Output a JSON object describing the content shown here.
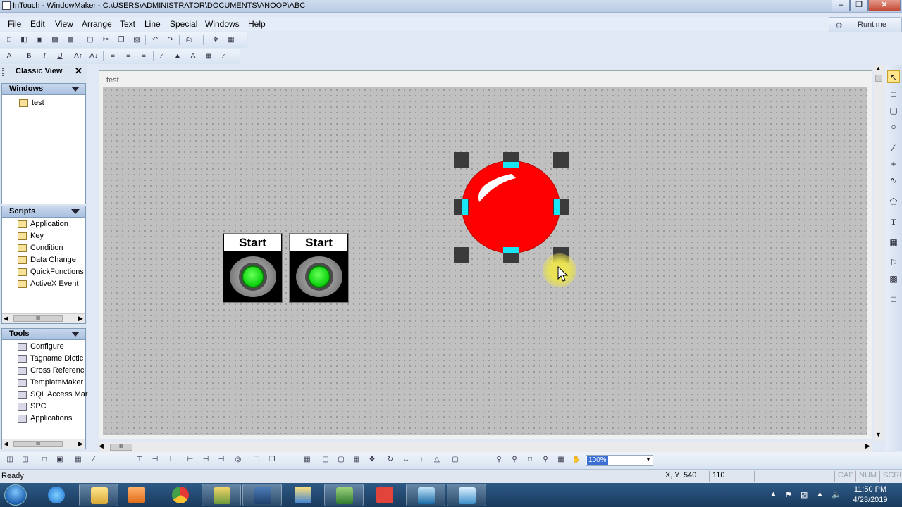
{
  "window": {
    "title": "InTouch - WindowMaker - C:\\USERS\\ADMINISTRATOR\\DOCUMENTS\\ANOOP\\ABC",
    "minimize_icon": "minimize-icon",
    "maximize_icon": "restore-icon",
    "close_icon": "close-icon"
  },
  "menu": {
    "items": [
      "File",
      "Edit",
      "View",
      "Arrange",
      "Text",
      "Line",
      "Special",
      "Windows",
      "Help"
    ],
    "runtime_label": "Runtime"
  },
  "left_panel": {
    "title": "Classic View",
    "windows_section": {
      "title": "Windows",
      "items": [
        "test"
      ]
    },
    "scripts_section": {
      "title": "Scripts",
      "items": [
        "Application",
        "Key",
        "Condition",
        "Data Change",
        "QuickFunctions",
        "ActiveX Event"
      ]
    },
    "tools_section": {
      "title": "Tools",
      "items": [
        "Configure",
        "Tagname Dictic",
        "Cross Reference",
        "TemplateMaker",
        "SQL Access Mar",
        "SPC",
        "Applications"
      ]
    },
    "scroll_thumb": "III"
  },
  "document": {
    "window_name": "test",
    "buttons": [
      {
        "label": "Start",
        "lamp_color": "#14d814"
      },
      {
        "label": "Start",
        "lamp_color": "#14d814"
      }
    ],
    "selected_object": {
      "type": "red-lamp",
      "color": "#ff0000",
      "handle_color": "#19e6f4"
    },
    "hscroll_thumb": "III"
  },
  "bottom_toolbar": {
    "zoom": "100%"
  },
  "status": {
    "text": "Ready",
    "xy_label": "X, Y",
    "x": "540",
    "y": "110",
    "cap": "CAP",
    "num": "NUM",
    "scrl": "SCRL"
  },
  "taskbar": {
    "time": "11:50 PM",
    "date": "4/23/2019"
  }
}
